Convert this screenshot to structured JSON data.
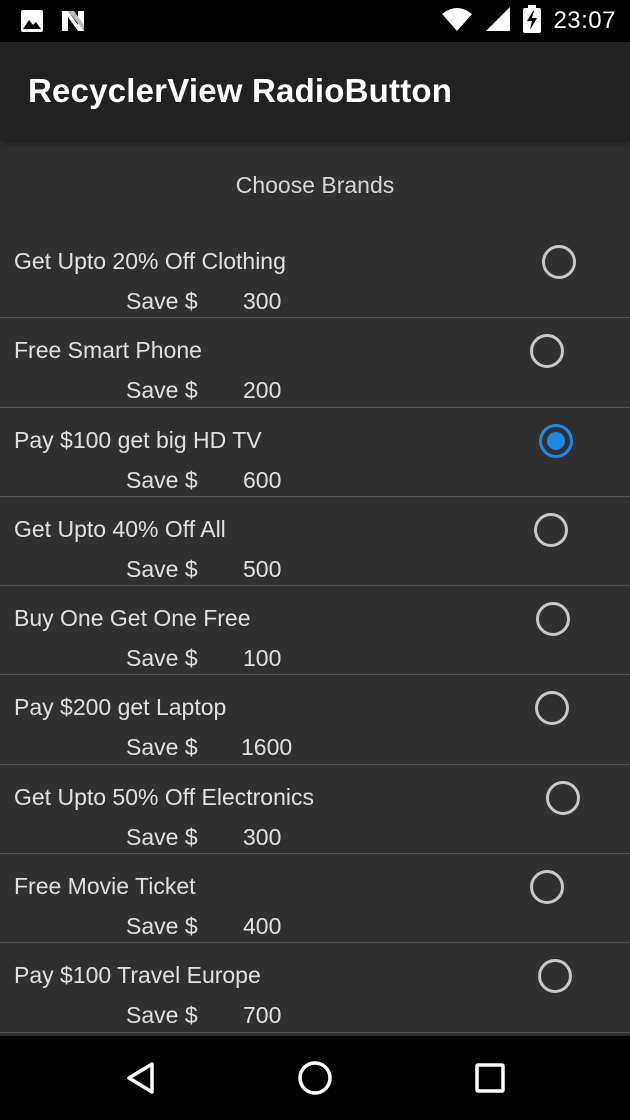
{
  "status_bar": {
    "time": "23:07",
    "icons": [
      "image-icon",
      "n-logo-icon",
      "wifi-icon",
      "cellular-signal-icon",
      "battery-charging-icon"
    ]
  },
  "app_bar": {
    "title": "RecyclerView RadioButton"
  },
  "list": {
    "header": "Choose Brands",
    "save_label": "Save $",
    "items": [
      {
        "title": "Get Upto 20% Off Clothing",
        "amount": "300",
        "selected": false
      },
      {
        "title": "Free Smart Phone",
        "amount": "200",
        "selected": false
      },
      {
        "title": "Pay $100 get big HD TV",
        "amount": "600",
        "selected": true
      },
      {
        "title": "Get Upto 40% Off All",
        "amount": "500",
        "selected": false
      },
      {
        "title": "Buy One Get One Free",
        "amount": "100",
        "selected": false
      },
      {
        "title": "Pay $200 get Laptop",
        "amount": "1600",
        "selected": false
      },
      {
        "title": "Get Upto 50% Off Electronics",
        "amount": "300",
        "selected": false
      },
      {
        "title": "Free Movie Ticket",
        "amount": "400",
        "selected": false
      },
      {
        "title": "Pay $100 Travel Europe",
        "amount": "700",
        "selected": false
      }
    ]
  },
  "nav_bar": {
    "icons": [
      "back-icon",
      "home-icon",
      "recents-icon"
    ]
  },
  "colors": {
    "accent": "#1e88e5",
    "background": "#303030",
    "app_bar": "#212121"
  }
}
